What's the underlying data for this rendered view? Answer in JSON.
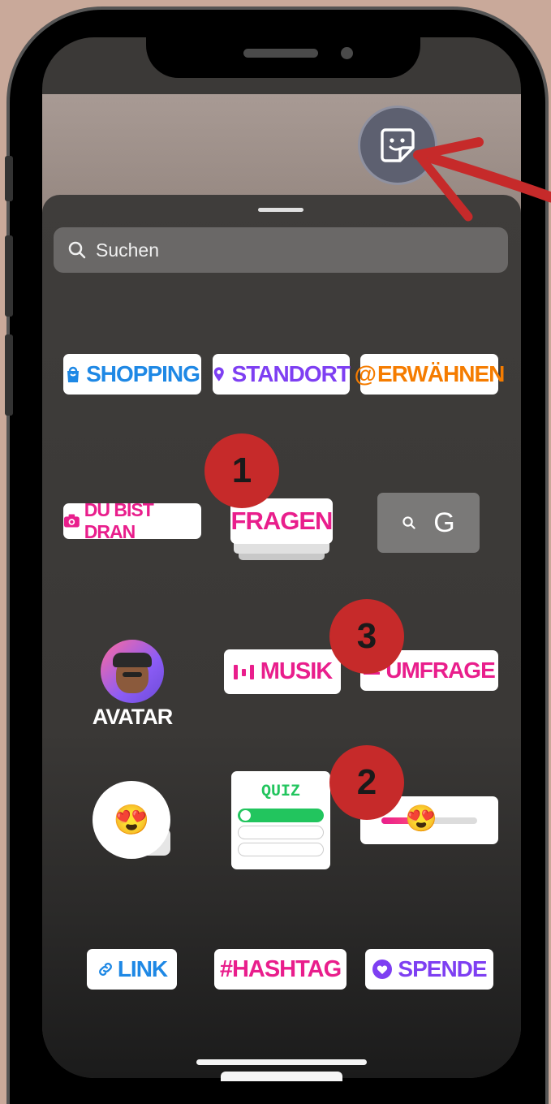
{
  "search": {
    "placeholder": "Suchen",
    "icon": "search-icon"
  },
  "stickers": {
    "shopping": "SHOPPING",
    "standort": "STANDORT",
    "erwaehnen": "ERWÄHNEN",
    "du_bist_dran": "DU BIST DRAN",
    "fragen": "FRAGEN",
    "gif_search": "G",
    "avatar": "AVATAR",
    "musik": "MUSIK",
    "umfrage": "UMFRAGE",
    "quiz": "QUIZ",
    "link": "LINK",
    "hashtag": "#HASHTAG",
    "spende": "SPENDE"
  },
  "badges": {
    "one": "1",
    "two": "2",
    "three": "3"
  },
  "emoji": {
    "reaction": "😍",
    "slider": "😍",
    "avatar": "🧑🏾"
  },
  "colors": {
    "shopping": "#1e88e5",
    "standort": "#7e3ff2",
    "erwaehnen": "#f57c00",
    "pink": "#e91e8c",
    "quiz": "#22c55e",
    "badge": "#c62a2a",
    "arrow": "#c62a2a"
  }
}
